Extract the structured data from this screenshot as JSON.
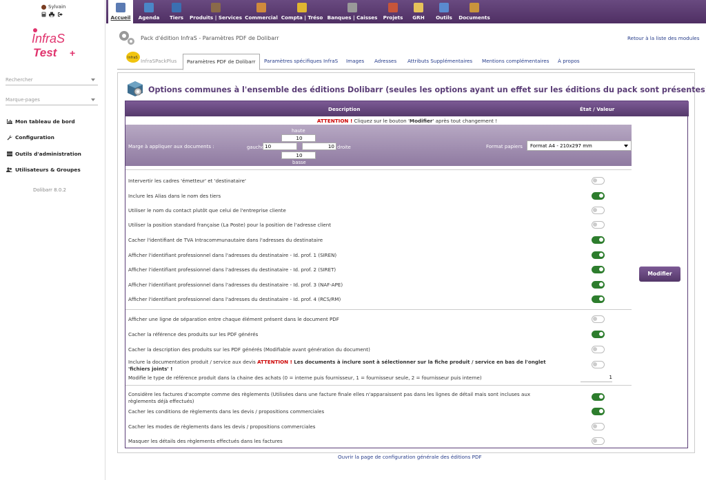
{
  "user": {
    "name": "Sylvain"
  },
  "logo": {
    "line1": "InfraS",
    "line2": "Test",
    "suffix": "+"
  },
  "sidebar": {
    "search_placeholder": "Rechercher",
    "bookmarks_placeholder": "Marque-pages",
    "items": [
      {
        "label": "Mon tableau de bord",
        "icon": "bar-chart-icon"
      },
      {
        "label": "Configuration",
        "icon": "wrench-icon"
      },
      {
        "label": "Outils d'administration",
        "icon": "server-icon"
      },
      {
        "label": "Utilisateurs & Groupes",
        "icon": "users-icon"
      }
    ],
    "version": "Dolibarr 8.0.2"
  },
  "topmenu": [
    {
      "label": "Accueil",
      "color": "#5b7bb3",
      "active": true
    },
    {
      "label": "Agenda",
      "color": "#4a87c7"
    },
    {
      "label": "Tiers",
      "color": "#3b6fb1"
    },
    {
      "label": "Produits | Services",
      "color": "#8a6a4a"
    },
    {
      "label": "Commercial",
      "color": "#d08a3c"
    },
    {
      "label": "Compta | Tréso",
      "color": "#e0b630"
    },
    {
      "label": "Banques | Caisses",
      "color": "#999"
    },
    {
      "label": "Projets",
      "color": "#c7553a"
    },
    {
      "label": "GRH",
      "color": "#e7c35a"
    },
    {
      "label": "Outils",
      "color": "#5a8ad0"
    },
    {
      "label": "Documents",
      "color": "#c8943c"
    }
  ],
  "page": {
    "title": "Pack d'édition InfraS - Paramètres PDF de Dolibarr",
    "back_link": "Retour à la liste des modules"
  },
  "subtabs": [
    {
      "label": "InfraSPackPlus",
      "state": "disabled"
    },
    {
      "label": "Paramètres PDF de Dolibarr",
      "state": "active"
    },
    {
      "label": "Paramètres spécifiques InfraS"
    },
    {
      "label": "Images"
    },
    {
      "label": "Adresses"
    },
    {
      "label": "Attributs Supplémentaires"
    },
    {
      "label": "Mentions complémentaires"
    },
    {
      "label": "À propos"
    }
  ],
  "section": {
    "title": "Options communes à l'ensemble des éditions Dolibarr (seules les options ayant un effet sur les éditions du pack sont présentes)",
    "col_desc": "Description",
    "col_state": "État / Valeur",
    "attention_label": "ATTENTION !",
    "attention_text": " Cliquez sur le bouton '",
    "attention_btn": "Modifier",
    "attention_end": "' après tout changement !"
  },
  "margins": {
    "label": "Marge à appliquer aux documents :",
    "haute_label": "haute",
    "haute": "10",
    "gauche_label": "gauche",
    "gauche": "10",
    "droite_label": "droite",
    "droite": "10",
    "basse_label": "basse",
    "basse": "10",
    "format_label": "Format papiers",
    "format_value": "Format A4 - 210x297 mm"
  },
  "options": [
    {
      "text": "Intervertir les cadres 'émetteur' et 'destinataire'",
      "on": false
    },
    {
      "text": "Inclure les Alias dans le nom des tiers",
      "on": true
    },
    {
      "text": "Utiliser le nom du contact plutôt que celui de l'entreprise cliente",
      "on": false
    },
    {
      "text": "Utiliser la position standard française (La Poste) pour la position de l'adresse client",
      "on": false
    },
    {
      "text": "Cacher l'identifiant de TVA Intracommunautaire dans l'adresses du destinataire",
      "on": true
    },
    {
      "text": "Afficher l'identifiant professionnel dans l'adresses du destinataire - Id. prof. 1 (SIREN)",
      "on": true
    },
    {
      "text": "Afficher l'identifiant professionnel dans l'adresses du destinataire - Id. prof. 2 (SIRET)",
      "on": true
    },
    {
      "text": "Afficher l'identifiant professionnel dans l'adresses du destinataire - Id. prof. 3 (NAF-APE)",
      "on": true
    },
    {
      "text": "Afficher l'identifiant professionnel dans l'adresses du destinataire - Id. prof. 4 (RCS/RM)",
      "on": true
    },
    {
      "text": "Afficher une ligne de séparation entre chaque élément présent dans le document PDF",
      "on": false
    },
    {
      "text": "Cacher la référence des produits sur les PDF générés",
      "on": true
    },
    {
      "text": "Cacher la description des produits sur les PDF générés (Modifiable avant génération du document)",
      "on": false
    },
    {
      "text": "Inclure la documentation produit / service aux devis ",
      "red": "ATTENTION !",
      "bold": " Les documents à inclure sont à sélectionner sur la fiche produit / service en bas de l'onglet 'fichiers joints' !",
      "on": false
    },
    {
      "text": "Modifie le type de référence produit dans la chaine des achats (0 = interne puis fournisseur, 1 = fournisseur seule, 2 = fournisseur puis interne)",
      "value": "1"
    },
    {
      "text": "Considère les factures d'acompte comme des règlements (Utilisées dans une facture finale elles n'apparaissent pas dans les lignes de détail mais sont incluses aux règlements déjà effectués)",
      "on": true
    },
    {
      "text": "Cacher les conditions de règlements dans les devis / propositions commerciales",
      "on": true
    },
    {
      "text": "Cacher les modes de règlements dans les devis / propositions commerciales",
      "on": false
    },
    {
      "text": "Masquer les détails des règlements effectués dans les factures",
      "on": false
    }
  ],
  "modify_button": "Modifier",
  "footer_link": "Ouvrir la page de configuration générale des éditions PDF"
}
